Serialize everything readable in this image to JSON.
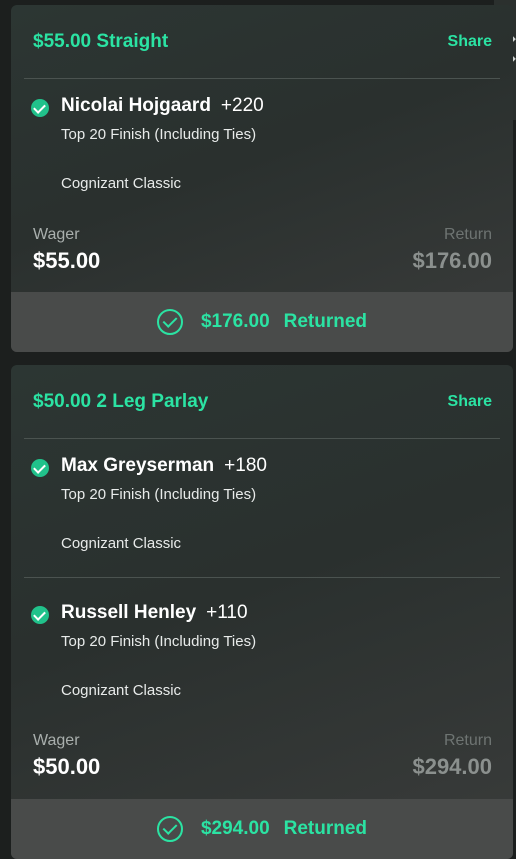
{
  "bets": [
    {
      "title": "$55.00 Straight",
      "share_label": "Share",
      "legs": [
        {
          "player": "Nicolai Hojgaard",
          "odds": "+220",
          "market": "Top 20 Finish (Including Ties)",
          "event": "Cognizant Classic",
          "status": "won"
        }
      ],
      "wager_label": "Wager",
      "wager": "$55.00",
      "return_label": "Return",
      "return": "$176.00",
      "result_amount": "$176.00",
      "result_label": "Returned"
    },
    {
      "title": "$50.00 2 Leg Parlay",
      "share_label": "Share",
      "legs": [
        {
          "player": "Max Greyserman",
          "odds": "+180",
          "market": "Top 20 Finish (Including Ties)",
          "event": "Cognizant Classic",
          "status": "won"
        },
        {
          "player": "Russell Henley",
          "odds": "+110",
          "market": "Top 20 Finish (Including Ties)",
          "event": "Cognizant Classic",
          "status": "won"
        }
      ],
      "wager_label": "Wager",
      "wager": "$50.00",
      "return_label": "Return",
      "return": "$294.00",
      "result_amount": "$294.00",
      "result_label": "Returned"
    }
  ],
  "icons": {
    "leg_status": "check-circle-filled-icon",
    "result": "check-circle-outline-icon",
    "side_tab": "chevron-left-icon"
  },
  "colors": {
    "accent": "#2be3a3",
    "check_fill": "#21c28b",
    "card_bg": "#2c3633",
    "footer_bg": "#494b4a"
  }
}
